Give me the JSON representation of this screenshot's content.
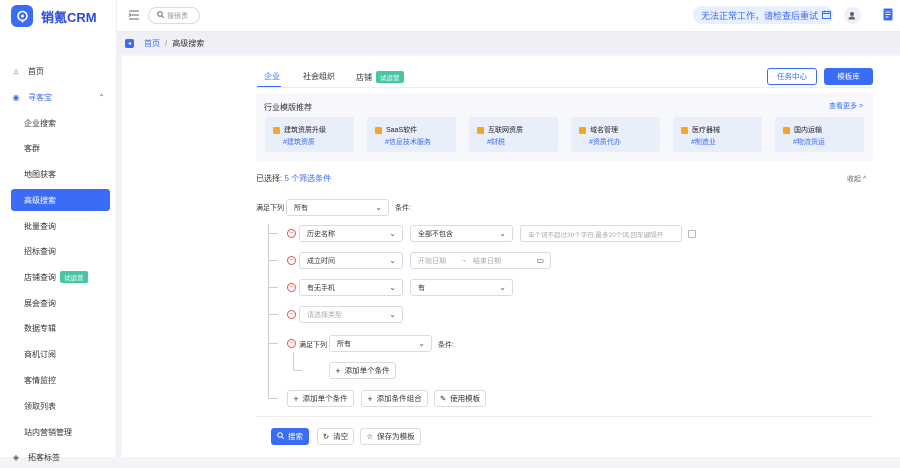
{
  "app": {
    "name": "销氪CRM"
  },
  "sidebar": {
    "items": [
      {
        "label": "首页"
      },
      {
        "label": "寻客宝"
      },
      {
        "label": "企业搜索"
      },
      {
        "label": "客群"
      },
      {
        "label": "地图获客"
      },
      {
        "label": "高级搜索"
      },
      {
        "label": "批量查询"
      },
      {
        "label": "招标查询"
      },
      {
        "label": "店铺查询",
        "badge": "试运营"
      },
      {
        "label": "展会查询"
      },
      {
        "label": "数据专辑"
      },
      {
        "label": "商机订阅"
      },
      {
        "label": "客情监控"
      },
      {
        "label": "领取列表"
      },
      {
        "label": "站内营销管理"
      },
      {
        "label": "拓客标签"
      }
    ]
  },
  "header": {
    "search_placeholder": "搜很贵",
    "notice": "无法正常工作，请检查后重试"
  },
  "breadcrumb": {
    "home": "首页",
    "current": "高级搜索"
  },
  "tabs": [
    {
      "label": "企业"
    },
    {
      "label": "社会组织"
    },
    {
      "label": "店铺",
      "badge": "试运营"
    }
  ],
  "actions": {
    "task_center": "任务中心",
    "template_lib": "模板库"
  },
  "templates": {
    "title": "行业模版推荐",
    "more": "查看更多 >",
    "cards": [
      {
        "name": "建筑资质升级",
        "tag": "#建筑资质"
      },
      {
        "name": "SaaS软件",
        "tag": "#信息技术服务"
      },
      {
        "name": "互联网资质",
        "tag": "#财税"
      },
      {
        "name": "域名管理",
        "tag": "#资质代办"
      },
      {
        "name": "医疗器械",
        "tag": "#制造业"
      },
      {
        "name": "国内运输",
        "tag": "#物流货运"
      }
    ]
  },
  "filters": {
    "selected_prefix": "已选择:",
    "selected_count": "5 个筛选条件",
    "collapse": "收起 ^",
    "match_prefix": "满足下列",
    "match_value": "所有",
    "match_suffix": "条件:",
    "rows": [
      {
        "field": "历史名称",
        "op": "全部不包含",
        "input_placeholder": "单个词不超过30个字符,最多20个词,回车键隔开"
      },
      {
        "field": "成立时间",
        "start_placeholder": "开始日期",
        "arrow": "→",
        "end_placeholder": "结束日期"
      },
      {
        "field": "有无手机",
        "value": "有"
      },
      {
        "field_placeholder": "请选择类型"
      }
    ],
    "nested": {
      "prefix": "满足下列",
      "value": "所有",
      "suffix": "条件:",
      "add_single": "添加单个条件"
    },
    "add_single": "添加单个条件",
    "add_group": "添加条件组合",
    "use_template": "使用模板"
  },
  "footer": {
    "search": "搜索",
    "clear": "清空",
    "save_template": "保存为模板"
  },
  "colors": {
    "primary": "#3b6cf6",
    "badge": "#48c6a4",
    "danger": "#e45656"
  }
}
